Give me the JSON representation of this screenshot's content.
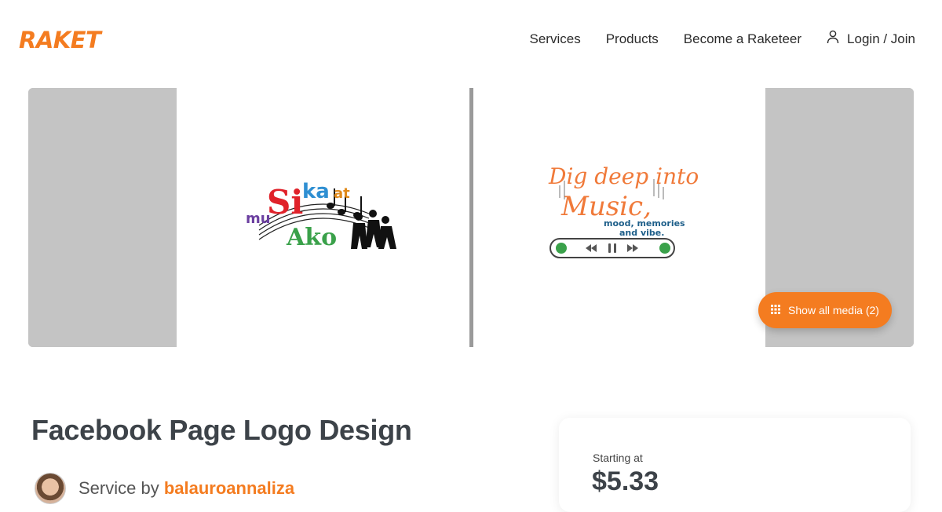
{
  "brand": {
    "name": "RAKET",
    "color": "#f47c20"
  },
  "nav": {
    "items": [
      "Services",
      "Products",
      "Become a Raketeer"
    ],
    "login_label": "Login / Join",
    "login_icon": "user-icon"
  },
  "gallery": {
    "images": [
      {
        "logo_text": [
          "mu",
          "Si",
          "ka",
          "at",
          "Ako"
        ]
      },
      {
        "logo_text": [
          "Dig deep into",
          "Music,",
          "mood, memories",
          "and vibe."
        ]
      }
    ],
    "show_media_label": "Show all media (2)",
    "show_media_icon": "grid-icon"
  },
  "service": {
    "title": "Facebook Page Logo Design",
    "by_prefix": "Service by",
    "seller": "balauroannaliza"
  },
  "pricing": {
    "starting_label": "Starting at",
    "price": "$5.33"
  }
}
